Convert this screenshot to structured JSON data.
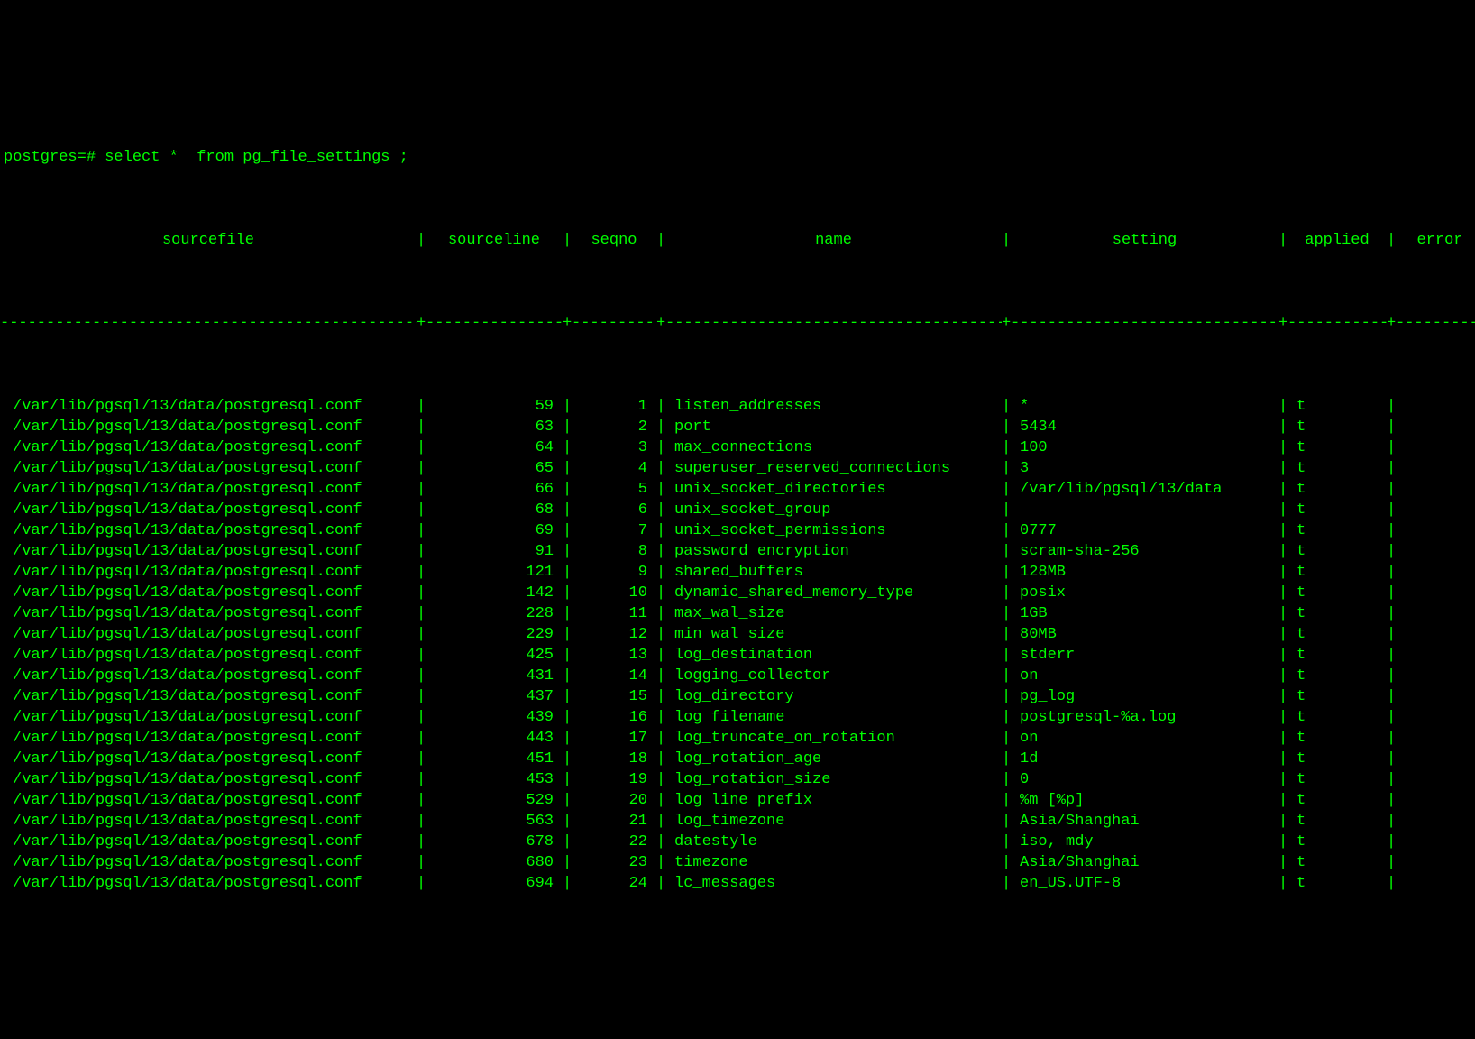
{
  "prompt": "postgres=# select *  from pg_file_settings ;",
  "headers": {
    "sourcefile": "sourcefile",
    "sourceline": "sourceline",
    "seqno": "seqno",
    "name": "name",
    "setting": "setting",
    "applied": "applied",
    "error": "error"
  },
  "sep": "|",
  "plus": "+",
  "dash_sourcefile": "----------------------------------------------",
  "dash_sourceline": "---------------",
  "dash_seqno": "---------",
  "dash_name": "-------------------------------------",
  "dash_setting": "-----------------------------",
  "dash_applied": "-----------",
  "dash_error": "---------------",
  "rows": [
    {
      "sourcefile": "/var/lib/pgsql/13/data/postgresql.conf",
      "sourceline": "59",
      "seqno": "1",
      "name": "listen_addresses",
      "setting": "*",
      "applied": "t",
      "error": ""
    },
    {
      "sourcefile": "/var/lib/pgsql/13/data/postgresql.conf",
      "sourceline": "63",
      "seqno": "2",
      "name": "port",
      "setting": "5434",
      "applied": "t",
      "error": ""
    },
    {
      "sourcefile": "/var/lib/pgsql/13/data/postgresql.conf",
      "sourceline": "64",
      "seqno": "3",
      "name": "max_connections",
      "setting": "100",
      "applied": "t",
      "error": ""
    },
    {
      "sourcefile": "/var/lib/pgsql/13/data/postgresql.conf",
      "sourceline": "65",
      "seqno": "4",
      "name": "superuser_reserved_connections",
      "setting": "3",
      "applied": "t",
      "error": ""
    },
    {
      "sourcefile": "/var/lib/pgsql/13/data/postgresql.conf",
      "sourceline": "66",
      "seqno": "5",
      "name": "unix_socket_directories",
      "setting": "/var/lib/pgsql/13/data",
      "applied": "t",
      "error": ""
    },
    {
      "sourcefile": "/var/lib/pgsql/13/data/postgresql.conf",
      "sourceline": "68",
      "seqno": "6",
      "name": "unix_socket_group",
      "setting": "",
      "applied": "t",
      "error": ""
    },
    {
      "sourcefile": "/var/lib/pgsql/13/data/postgresql.conf",
      "sourceline": "69",
      "seqno": "7",
      "name": "unix_socket_permissions",
      "setting": "0777",
      "applied": "t",
      "error": ""
    },
    {
      "sourcefile": "/var/lib/pgsql/13/data/postgresql.conf",
      "sourceline": "91",
      "seqno": "8",
      "name": "password_encryption",
      "setting": "scram-sha-256",
      "applied": "t",
      "error": ""
    },
    {
      "sourcefile": "/var/lib/pgsql/13/data/postgresql.conf",
      "sourceline": "121",
      "seqno": "9",
      "name": "shared_buffers",
      "setting": "128MB",
      "applied": "t",
      "error": ""
    },
    {
      "sourcefile": "/var/lib/pgsql/13/data/postgresql.conf",
      "sourceline": "142",
      "seqno": "10",
      "name": "dynamic_shared_memory_type",
      "setting": "posix",
      "applied": "t",
      "error": ""
    },
    {
      "sourcefile": "/var/lib/pgsql/13/data/postgresql.conf",
      "sourceline": "228",
      "seqno": "11",
      "name": "max_wal_size",
      "setting": "1GB",
      "applied": "t",
      "error": ""
    },
    {
      "sourcefile": "/var/lib/pgsql/13/data/postgresql.conf",
      "sourceline": "229",
      "seqno": "12",
      "name": "min_wal_size",
      "setting": "80MB",
      "applied": "t",
      "error": ""
    },
    {
      "sourcefile": "/var/lib/pgsql/13/data/postgresql.conf",
      "sourceline": "425",
      "seqno": "13",
      "name": "log_destination",
      "setting": "stderr",
      "applied": "t",
      "error": ""
    },
    {
      "sourcefile": "/var/lib/pgsql/13/data/postgresql.conf",
      "sourceline": "431",
      "seqno": "14",
      "name": "logging_collector",
      "setting": "on",
      "applied": "t",
      "error": ""
    },
    {
      "sourcefile": "/var/lib/pgsql/13/data/postgresql.conf",
      "sourceline": "437",
      "seqno": "15",
      "name": "log_directory",
      "setting": "pg_log",
      "applied": "t",
      "error": ""
    },
    {
      "sourcefile": "/var/lib/pgsql/13/data/postgresql.conf",
      "sourceline": "439",
      "seqno": "16",
      "name": "log_filename",
      "setting": "postgresql-%a.log",
      "applied": "t",
      "error": ""
    },
    {
      "sourcefile": "/var/lib/pgsql/13/data/postgresql.conf",
      "sourceline": "443",
      "seqno": "17",
      "name": "log_truncate_on_rotation",
      "setting": "on",
      "applied": "t",
      "error": ""
    },
    {
      "sourcefile": "/var/lib/pgsql/13/data/postgresql.conf",
      "sourceline": "451",
      "seqno": "18",
      "name": "log_rotation_age",
      "setting": "1d",
      "applied": "t",
      "error": ""
    },
    {
      "sourcefile": "/var/lib/pgsql/13/data/postgresql.conf",
      "sourceline": "453",
      "seqno": "19",
      "name": "log_rotation_size",
      "setting": "0",
      "applied": "t",
      "error": ""
    },
    {
      "sourcefile": "/var/lib/pgsql/13/data/postgresql.conf",
      "sourceline": "529",
      "seqno": "20",
      "name": "log_line_prefix",
      "setting": "%m [%p]",
      "applied": "t",
      "error": ""
    },
    {
      "sourcefile": "/var/lib/pgsql/13/data/postgresql.conf",
      "sourceline": "563",
      "seqno": "21",
      "name": "log_timezone",
      "setting": "Asia/Shanghai",
      "applied": "t",
      "error": ""
    },
    {
      "sourcefile": "/var/lib/pgsql/13/data/postgresql.conf",
      "sourceline": "678",
      "seqno": "22",
      "name": "datestyle",
      "setting": "iso, mdy",
      "applied": "t",
      "error": ""
    },
    {
      "sourcefile": "/var/lib/pgsql/13/data/postgresql.conf",
      "sourceline": "680",
      "seqno": "23",
      "name": "timezone",
      "setting": "Asia/Shanghai",
      "applied": "t",
      "error": ""
    },
    {
      "sourcefile": "/var/lib/pgsql/13/data/postgresql.conf",
      "sourceline": "694",
      "seqno": "24",
      "name": "lc_messages",
      "setting": "en_US.UTF-8",
      "applied": "t",
      "error": ""
    }
  ]
}
